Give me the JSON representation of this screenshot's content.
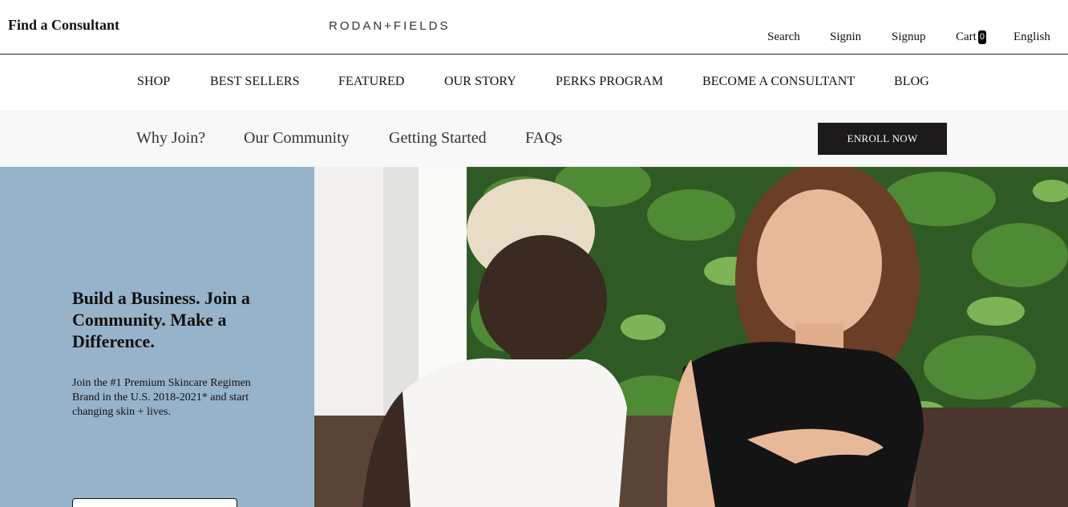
{
  "header": {
    "find_consultant": "Find a Consultant",
    "logo": "RODAN+FIELDS",
    "utility": {
      "search": "Search",
      "signin": "Signin",
      "signup": "Signup",
      "cart": "Cart",
      "cart_count": "0",
      "language": "English"
    }
  },
  "main_nav": [
    {
      "label": "SHOP"
    },
    {
      "label": "BEST SELLERS"
    },
    {
      "label": "FEATURED"
    },
    {
      "label": "OUR STORY"
    },
    {
      "label": "PERKS PROGRAM"
    },
    {
      "label": "BECOME A CONSULTANT"
    },
    {
      "label": "BLOG"
    }
  ],
  "sub_nav": {
    "items": [
      {
        "label": "Why Join?"
      },
      {
        "label": "Our Community"
      },
      {
        "label": "Getting Started"
      },
      {
        "label": "FAQs"
      }
    ],
    "enroll_label": "ENROLL NOW"
  },
  "hero": {
    "title": "Build a Business. Join a Community. Make a Difference.",
    "text": "Join the #1 Premium Skincare Regimen Brand in the U.S. 2018-2021* and start changing skin + lives.",
    "panel_color": "#97b3ca"
  },
  "colors": {
    "enroll_button": "#1c1a1a",
    "cart_badge": "#000000"
  }
}
